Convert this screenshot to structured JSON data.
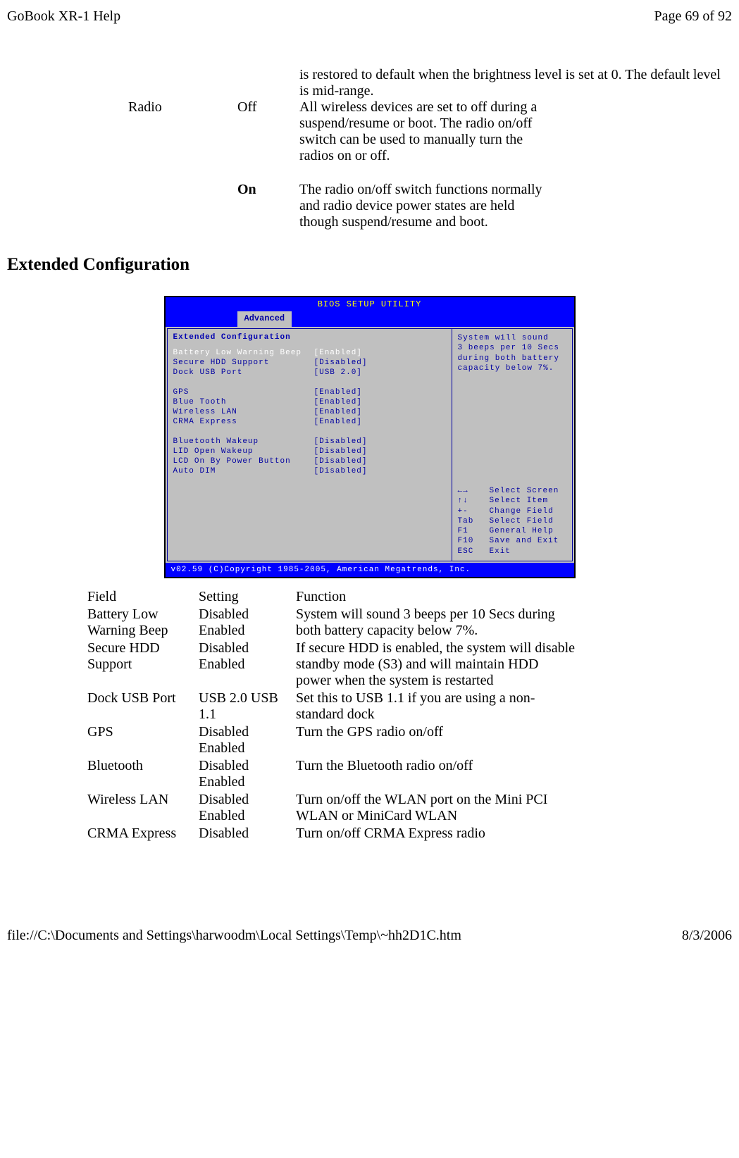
{
  "header": {
    "left": "GoBook XR-1 Help",
    "right": "Page 69 of 92"
  },
  "prev_continued": {
    "desc": "is restored to default when the brightness level is set at 0. The default level is mid-range."
  },
  "radio": {
    "field": "Radio",
    "off": {
      "label": "Off",
      "desc": "All wireless devices are set to off during a suspend/resume or boot.  The radio on/off switch can be used to manually turn the radios on or off."
    },
    "on": {
      "label": "On",
      "desc": "The radio on/off switch functions normally and radio device power states are held though suspend/resume and boot."
    }
  },
  "heading": "Extended Configuration",
  "bios": {
    "title": "BIOS   SETUP   UTILITY",
    "tab": "Advanced",
    "section": "Extended Configuration",
    "items": [
      {
        "label": "Battery Low Warning Beep",
        "val": "[Enabled]",
        "selected": true
      },
      {
        "label": "Secure HDD Support",
        "val": "[Disabled]"
      },
      {
        "label": "Dock USB Port",
        "val": "[USB 2.0]"
      }
    ],
    "group2": [
      {
        "label": "GPS",
        "val": "[Enabled]"
      },
      {
        "label": "Blue Tooth",
        "val": "[Enabled]"
      },
      {
        "label": "Wireless  LAN",
        "val": "[Enabled]"
      },
      {
        "label": "CRMA Express",
        "val": "[Enabled]"
      }
    ],
    "group3": [
      {
        "label": "Bluetooth Wakeup",
        "val": "[Disabled]"
      },
      {
        "label": "LID Open Wakeup",
        "val": "[Disabled]"
      },
      {
        "label": "LCD On By Power Button",
        "val": "[Disabled]"
      },
      {
        "label": "Auto DIM",
        "val": "[Disabled]"
      }
    ],
    "hint": {
      "l1": "System will sound",
      "l2": "3 beeps per 10 Secs",
      "l3": "during both battery",
      "l4": "capacity below 7%."
    },
    "keys": [
      {
        "k": "←→",
        "d": "Select Screen"
      },
      {
        "k": "↑↓",
        "d": "Select Item"
      },
      {
        "k": "+-",
        "d": "Change Field"
      },
      {
        "k": "Tab",
        "d": "Select Field"
      },
      {
        "k": "F1",
        "d": "General Help"
      },
      {
        "k": "F10",
        "d": "Save and Exit"
      },
      {
        "k": "ESC",
        "d": "Exit"
      }
    ],
    "footer": "v02.59 (C)Copyright 1985-2005, American Megatrends, Inc."
  },
  "table": {
    "head": {
      "field": "Field",
      "setting": "Setting",
      "func": "Function"
    },
    "rows": [
      {
        "field": "Battery Low Warning Beep",
        "setting": "Disabled Enabled",
        "func": "System will sound 3 beeps per 10 Secs during both battery capacity below 7%."
      },
      {
        "field": "Secure HDD Support",
        "setting": "Disabled Enabled",
        "func": "If secure HDD is enabled, the system will disable standby mode (S3) and will maintain HDD power when the system is restarted"
      },
      {
        "field": "Dock USB Port",
        "setting": "USB 2.0 USB 1.1",
        "func": "Set this to USB 1.1 if you are using a non-standard dock"
      },
      {
        "field": "GPS",
        "setting": "Disabled Enabled",
        "func": "Turn the GPS radio on/off"
      },
      {
        "field": "Bluetooth",
        "setting": "Disabled Enabled",
        "func": "Turn the Bluetooth radio on/off"
      },
      {
        "field": "Wireless LAN",
        "setting": "Disabled Enabled",
        "func": "Turn on/off the WLAN port on the Mini PCI WLAN or MiniCard WLAN"
      },
      {
        "field": "CRMA Express",
        "setting": "Disabled",
        "func": "Turn on/off CRMA Express radio"
      }
    ]
  },
  "footer": {
    "left": "file://C:\\Documents and Settings\\harwoodm\\Local Settings\\Temp\\~hh2D1C.htm",
    "right": "8/3/2006"
  }
}
